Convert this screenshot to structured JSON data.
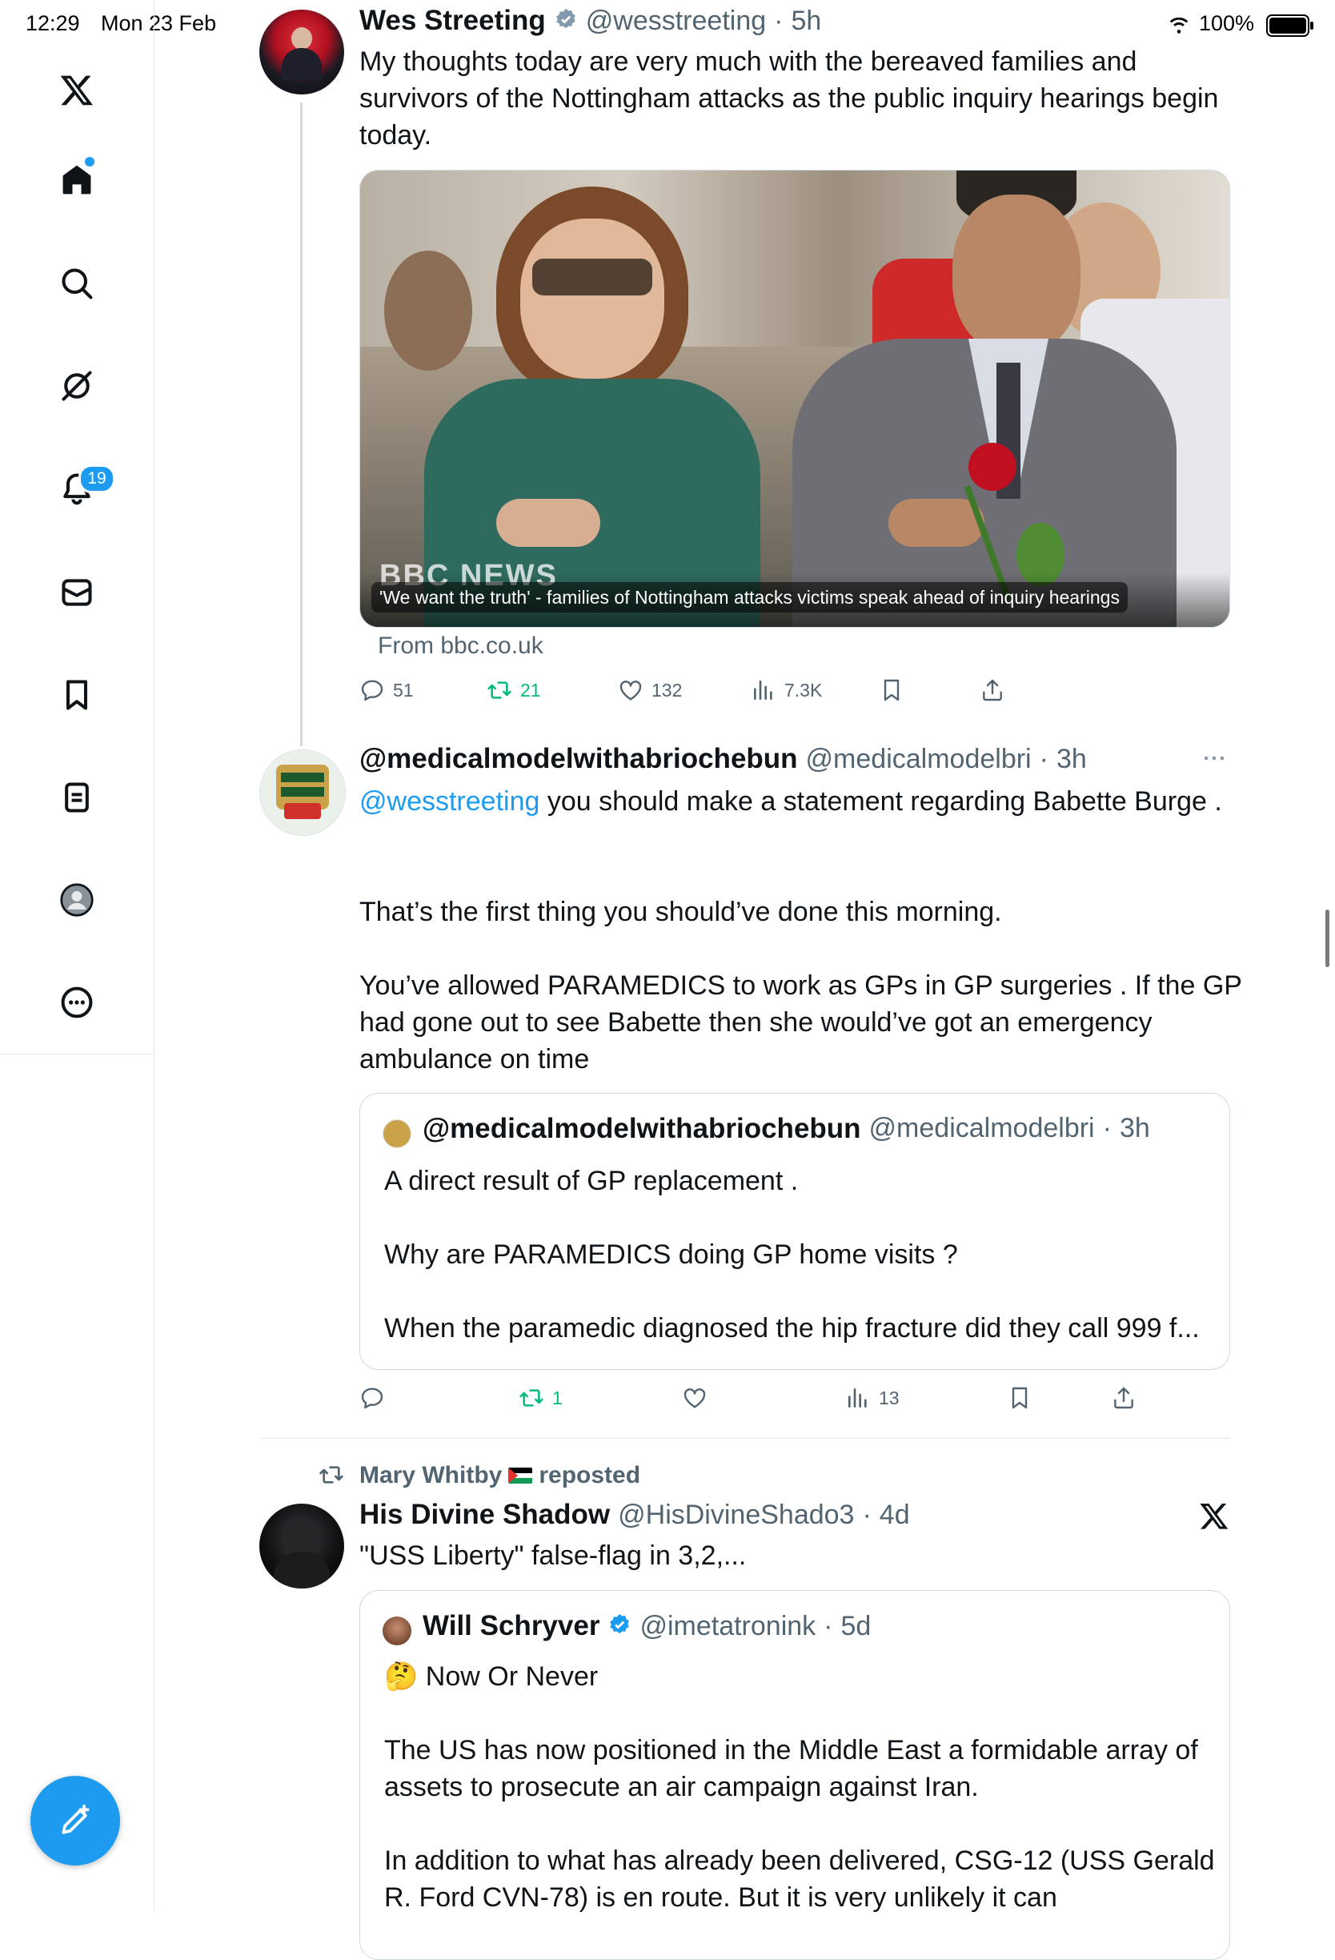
{
  "status_bar": {
    "time": "12:29",
    "date": "Mon 23 Feb",
    "battery": "100%"
  },
  "sidebar": {
    "notifications_badge": "19"
  },
  "tweets": [
    {
      "author_name": "Wes Streeting",
      "handle": "@wesstreeting",
      "time": "5h",
      "text": "My thoughts today are very much with the bereaved families and survivors of the Nottingham attacks as the public inquiry hearings begin today.",
      "card": {
        "image_caption": "'We want the truth' - families of Nottingham attacks victims speak ahead of inquiry hearings",
        "logo_text": "BBC NEWS",
        "source": "From bbc.co.uk"
      },
      "replies": "51",
      "reposts": "21",
      "likes": "132",
      "views": "7.3K"
    },
    {
      "author_name": "@medicalmodelwithabriochebun",
      "handle": "@medicalmodelbri",
      "time": "3h",
      "mention": "@wesstreeting",
      "text_after_mention": " you should make a statement regarding Babette Burge .",
      "text_body": "That’s the first thing you should’ve done this morning.\n\nYou’ve allowed PARAMEDICS to work as GPs in GP surgeries . If the GP had gone out to see Babette then she would’ve got an emergency ambulance on time",
      "quote": {
        "author_name": "@medicalmodelwithabriochebun",
        "handle": "@medicalmodelbri",
        "time": "3h",
        "text": "A direct result of GP replacement .\n\nWhy are PARAMEDICS doing GP home visits ?\n\nWhen the paramedic diagnosed the hip fracture did they call 999 f..."
      },
      "reposts": "1",
      "views": "13"
    },
    {
      "reposted_by": "Mary Whitby",
      "reposted_label": "reposted",
      "author_name": "His Divine Shadow",
      "handle": "@HisDivineShado3",
      "time": "4d",
      "text": "\"USS Liberty\" false-flag in 3,2,...",
      "quote": {
        "author_name": "Will Schryver",
        "handle": "@imetatronink",
        "time": "5d",
        "emoji": "🤔",
        "headline": "Now Or Never",
        "text": "The US has now positioned in the Middle East a formidable array of assets to prosecute an air campaign against Iran.\n\nIn addition to what has already been delivered, CSG-12 (USS Gerald R. Ford CVN-78) is en route. But it is very unlikely it can"
      }
    }
  ]
}
